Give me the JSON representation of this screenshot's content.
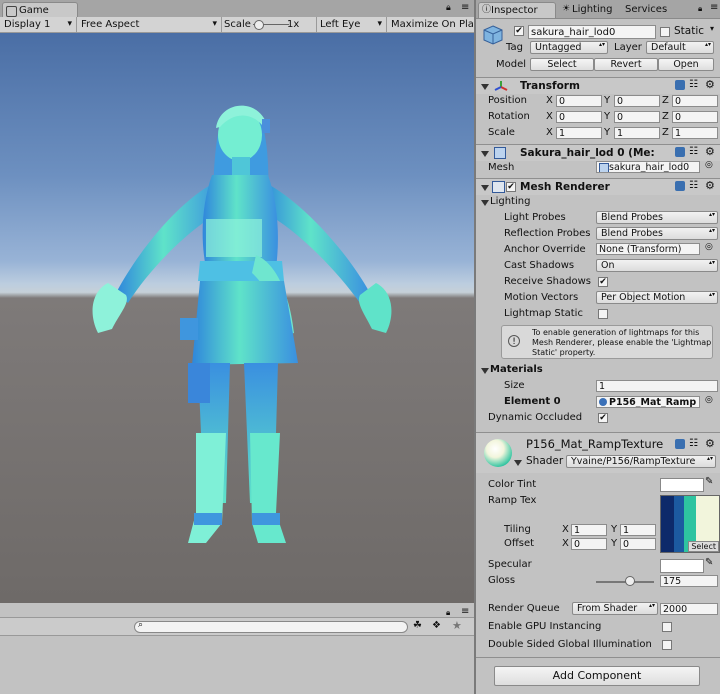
{
  "game": {
    "tab_label": "Game",
    "toolbar": {
      "display": "Display 1",
      "aspect": "Free Aspect",
      "scale_label": "Scale",
      "scale_value": "1x",
      "eye": "Left Eye",
      "maximize": "Maximize On Play"
    },
    "console_search_placeholder": ""
  },
  "inspector": {
    "tabs": [
      "Inspector",
      "Lighting",
      "Services"
    ],
    "object": {
      "name": "sakura_hair_lod0",
      "static_label": "Static",
      "tag_label": "Tag",
      "tag_value": "Untagged",
      "layer_label": "Layer",
      "layer_value": "Default",
      "model_label": "Model",
      "model_buttons": [
        "Select",
        "Revert",
        "Open"
      ]
    },
    "transform": {
      "title": "Transform",
      "rows": [
        {
          "label": "Position",
          "x": "0",
          "y": "0",
          "z": "0"
        },
        {
          "label": "Rotation",
          "x": "0",
          "y": "0",
          "z": "0"
        },
        {
          "label": "Scale",
          "x": "1",
          "y": "1",
          "z": "1"
        }
      ],
      "axis_x": "X",
      "axis_y": "Y",
      "axis_z": "Z"
    },
    "mesh_filter": {
      "title": "Sakura_hair_lod 0 (Me:",
      "mesh_label": "Mesh",
      "mesh_value": "sakura_hair_lod0"
    },
    "mesh_renderer": {
      "title": "Mesh Renderer",
      "lighting_label": "Lighting",
      "light_probes_label": "Light Probes",
      "light_probes_value": "Blend Probes",
      "reflection_probes_label": "Reflection Probes",
      "reflection_probes_value": "Blend Probes",
      "anchor_override_label": "Anchor Override",
      "anchor_override_value": "None (Transform)",
      "cast_shadows_label": "Cast Shadows",
      "cast_shadows_value": "On",
      "receive_shadows_label": "Receive Shadows",
      "motion_vectors_label": "Motion Vectors",
      "motion_vectors_value": "Per Object Motion",
      "lightmap_static_label": "Lightmap Static",
      "help_text": "To enable generation of lightmaps for this Mesh Renderer, please enable the 'Lightmap Static' property.",
      "materials_label": "Materials",
      "size_label": "Size",
      "size_value": "1",
      "element0_label": "Element 0",
      "element0_value": "P156_Mat_Ramp",
      "dynamic_occluded_label": "Dynamic Occluded"
    },
    "material": {
      "name": "P156_Mat_RampTexture",
      "shader_label": "Shader",
      "shader_value": "Yvaine/P156/RampTexture",
      "color_tint_label": "Color Tint",
      "ramp_tex_label": "Ramp Tex",
      "tiling_label": "Tiling",
      "tiling_x": "1",
      "tiling_y": "1",
      "offset_label": "Offset",
      "offset_x": "0",
      "offset_y": "0",
      "select_label": "Select",
      "specular_label": "Specular",
      "gloss_label": "Gloss",
      "gloss_value": "175",
      "gloss_slider_fraction": 0.58,
      "render_queue_label": "Render Queue",
      "render_queue_mode": "From Shader",
      "render_queue_value": "2000",
      "gpu_instancing_label": "Enable GPU Instancing",
      "dsgi_label": "Double Sided Global Illumination"
    },
    "add_component_label": "Add Component"
  },
  "colors": {
    "sky_top": "#4a6ea5",
    "ground": "#6e6a68",
    "model_cyan": "#5fe3c9",
    "model_blue": "#3a8fe0",
    "ramp_navy": "#0d2a6a",
    "ramp_green": "#2ec4a0",
    "ramp_cream": "#f2f5dc"
  }
}
